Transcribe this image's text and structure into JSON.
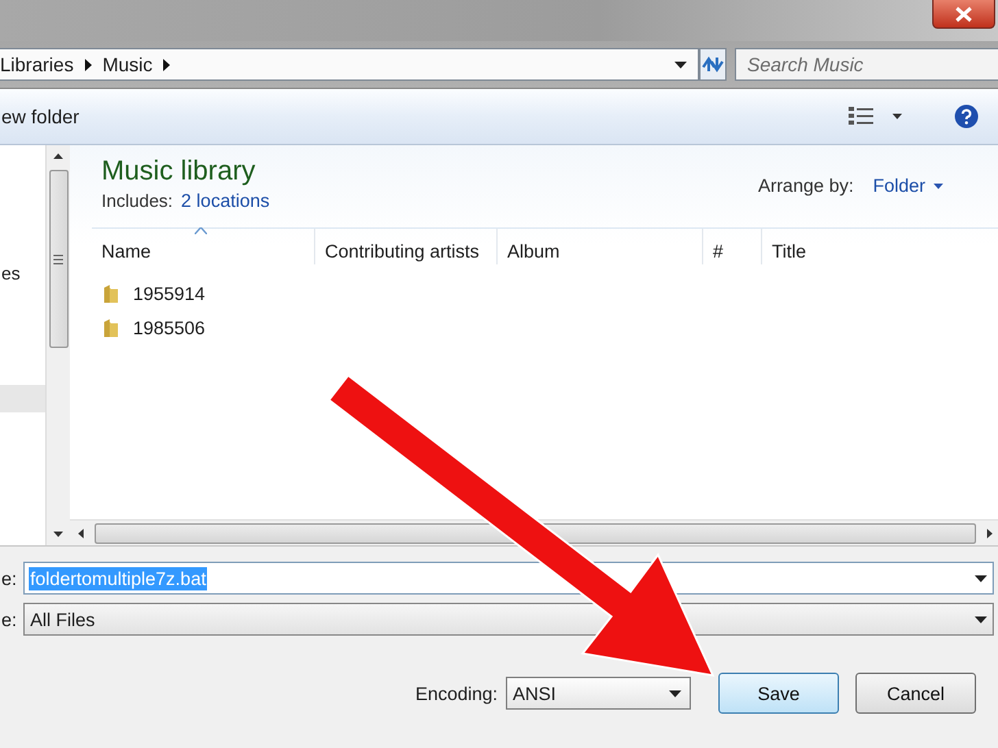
{
  "address_bar": {
    "breadcrumbs": [
      "Libraries",
      "Music"
    ]
  },
  "search": {
    "placeholder": "Search Music"
  },
  "toolbar": {
    "new_folder": "ew folder"
  },
  "sidebar": {
    "items": [
      "es"
    ]
  },
  "library": {
    "title": "Music library",
    "includes_label": "Includes:",
    "includes_link": "2 locations",
    "arrange_label": "Arrange by:",
    "arrange_value": "Folder"
  },
  "table": {
    "columns": [
      {
        "label": "Name",
        "sorted": true
      },
      {
        "label": "Contributing artists",
        "sorted": false
      },
      {
        "label": "Album",
        "sorted": false
      },
      {
        "label": "#",
        "sorted": false
      },
      {
        "label": "Title",
        "sorted": false
      }
    ],
    "rows": [
      {
        "name": "1955914"
      },
      {
        "name": "1985506"
      }
    ]
  },
  "file_name": {
    "label": "e:",
    "value": "foldertomultiple7z.bat",
    "selected": true
  },
  "file_type": {
    "label": "e:",
    "value": "All Files"
  },
  "encoding": {
    "label": "Encoding:",
    "value": "ANSI"
  },
  "buttons": [
    {
      "label": "Save",
      "default": true
    },
    {
      "label": "Cancel",
      "default": false
    }
  ]
}
